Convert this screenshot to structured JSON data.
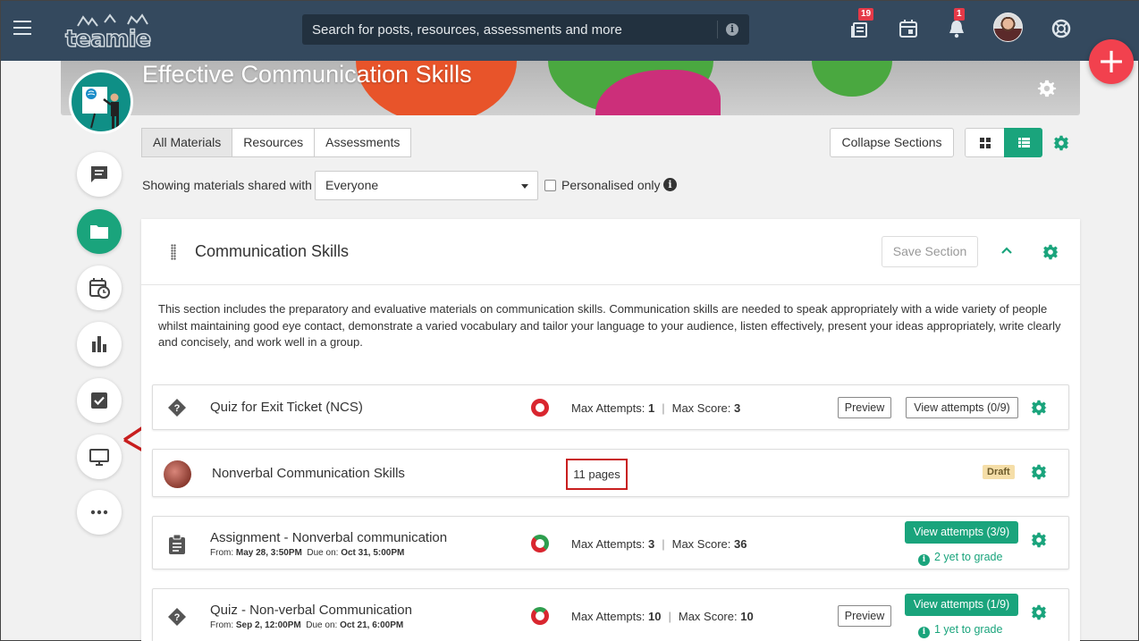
{
  "header": {
    "logo_text": "teamie",
    "search_placeholder": "Search for posts, resources, assessments and more",
    "icons": [
      "menu-icon",
      "library-icon",
      "calendar-icon",
      "bell-icon",
      "support-icon"
    ],
    "library_badge": "19",
    "notification_badge": "1"
  },
  "fab_label": "+",
  "course": {
    "title": "Effective Communication Skills"
  },
  "tabs": [
    "All Materials",
    "Resources",
    "Assessments"
  ],
  "collapse_label": "Collapse Sections",
  "filter": {
    "label": "Showing materials shared with",
    "value": "Everyone",
    "personalised_label": "Personalised only"
  },
  "section": {
    "title": "Communication Skills",
    "save_label": "Save Section",
    "description": "This section includes the preparatory and evaluative materials on communication skills. Communication skills are needed to speak appropriately with a wide variety of people whilst maintaining good eye contact, demonstrate a varied vocabulary and tailor your language to your audience, listen effectively, present your ideas appropriately, write clearly and concisely, and work well in a group."
  },
  "items": [
    {
      "title": "Quiz for Exit Ticket (NCS)",
      "max_attempts_label": "Max Attempts:",
      "max_attempts": "1",
      "max_score_label": "Max Score:",
      "max_score": "3",
      "preview_label": "Preview",
      "attempts_label": "View attempts (0/9)"
    },
    {
      "title": "Nonverbal Communication Skills",
      "pages": "11 pages",
      "status": "Draft"
    },
    {
      "title": "Assignment - Nonverbal communication",
      "from_label": "From:",
      "from": "May 28, 3:50PM",
      "due_label": "Due on:",
      "due": "Oct 31, 5:00PM",
      "max_attempts_label": "Max Attempts:",
      "max_attempts": "3",
      "max_score_label": "Max Score:",
      "max_score": "36",
      "attempts_label": "View attempts (3/9)",
      "grade_label": "2 yet to grade"
    },
    {
      "title": "Quiz - Non-verbal Communication",
      "from_label": "From:",
      "from": "Sep 2, 12:00PM",
      "due_label": "Due on:",
      "due": "Oct 21, 6:00PM",
      "max_attempts_label": "Max Attempts:",
      "max_attempts": "10",
      "max_score_label": "Max Score:",
      "max_score": "10",
      "preview_label": "Preview",
      "attempts_label": "View attempts (1/9)",
      "grade_label": "1 yet to grade"
    }
  ],
  "sidebar_icons": [
    "posts-icon",
    "materials-icon",
    "schedule-icon",
    "gradebook-icon",
    "assessments-icon",
    "classroom-icon",
    "more-icon"
  ],
  "colors": {
    "header": "#34495e",
    "accent": "#1aa47c",
    "fab": "#f2414e",
    "annotation": "#c81e1e"
  }
}
